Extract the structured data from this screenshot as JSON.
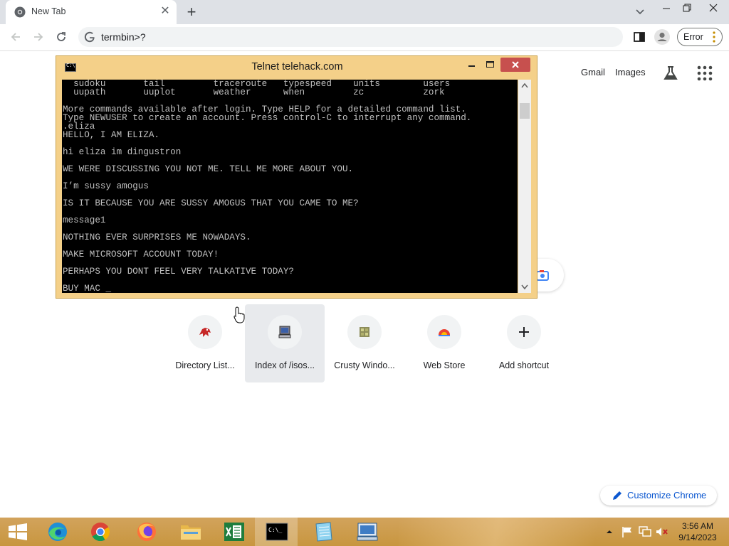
{
  "browser": {
    "tab": {
      "title": "New Tab",
      "favicon": "chrome-icon"
    },
    "address_bar": {
      "text": "termbin>?",
      "engine_icon": "google-g-icon"
    },
    "profile_status": {
      "label": "Error"
    }
  },
  "ntp": {
    "header_links": [
      "Gmail",
      "Images"
    ],
    "shortcuts": [
      {
        "label": "Directory List...",
        "icon": "red-dragon-icon"
      },
      {
        "label": "Index of /isos...",
        "icon": "old-computer-icon"
      },
      {
        "label": "Crusty Windo...",
        "icon": "crusty-window-icon"
      },
      {
        "label": "Web Store",
        "icon": "webstore-icon"
      },
      {
        "label": "Add shortcut",
        "icon": "plus-icon"
      }
    ],
    "customize": {
      "label": "Customize Chrome"
    }
  },
  "console": {
    "title": "Telnet telehack.com",
    "lines": [
      "  sudoku       tail         traceroute   typespeed    units        users",
      "  uupath       uuplot       weather      when         zc           zork",
      "",
      "More commands available after login. Type HELP for a detailed command list.",
      "Type NEWUSER to create an account. Press control-C to interrupt any command.",
      ".eliza",
      "HELLO, I AM ELIZA.",
      "",
      "hi eliza im dingustron",
      "",
      "WE WERE DISCUSSING YOU NOT ME. TELL ME MORE ABOUT YOU.",
      "",
      "I’m sussy amogus",
      "",
      "IS IT BECAUSE YOU ARE SUSSY AMOGUS THAT YOU CAME TO ME?",
      "",
      "message1",
      "",
      "NOTHING EVER SURPRISES ME NOWADAYS.",
      "",
      "MAKE MICROSOFT ACCOUNT TODAY!",
      "",
      "PERHAPS YOU DONT FEEL VERY TALKATIVE TODAY?",
      "",
      "BUY MAC _"
    ]
  },
  "taskbar": {
    "items": [
      "start-button",
      "edge-icon",
      "chrome-icon",
      "firefox-icon",
      "file-explorer-icon",
      "excel-icon",
      "command-prompt-icon",
      "notepad-icon",
      "remote-desktop-icon"
    ],
    "clock": {
      "time": "3:56 AM",
      "date": "9/14/2023"
    }
  },
  "colors": {
    "taskbar": "#c8963f",
    "console_frame": "#f4d089",
    "console_close": "#c7504e",
    "customize_text": "#0b57d0"
  }
}
